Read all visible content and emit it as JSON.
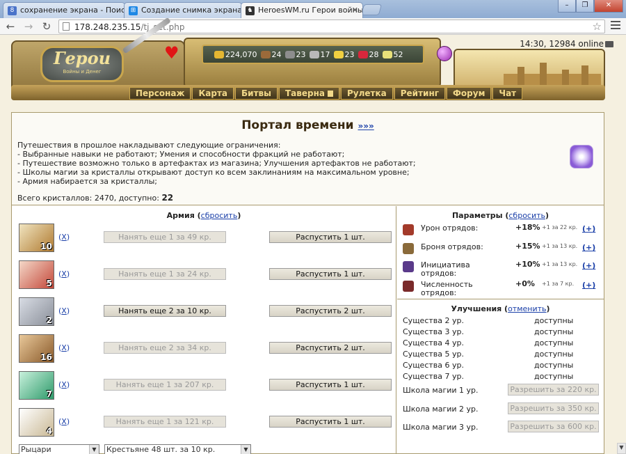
{
  "browser": {
    "tabs": [
      {
        "title": "сохранение экрана - Поиск",
        "icon_color": "#4a73c9",
        "icon_glyph": "8"
      },
      {
        "title": "Создание снимка экрана",
        "icon_color": "#1e88e5",
        "icon_glyph": "⊞"
      },
      {
        "title": "HeroesWM.ru Герои войны",
        "icon_color": "#333333",
        "icon_glyph": "♞"
      }
    ],
    "url_host": "178.248.235.15",
    "url_path": "/tj_set.php",
    "icons": [
      "back-arrow-icon",
      "forward-arrow-icon",
      "reload-icon",
      "star-icon",
      "menu-icon"
    ]
  },
  "header": {
    "logo_title": "Герои",
    "logo_subtitle": "Войны и Денег",
    "resources": [
      {
        "name": "gold",
        "value": "224,070",
        "color": "#e4b632"
      },
      {
        "name": "wood",
        "value": "24",
        "color": "#9b6a3a"
      },
      {
        "name": "ore",
        "value": "23",
        "color": "#8d8d8d"
      },
      {
        "name": "mercury",
        "value": "17",
        "color": "#b9b9b9"
      },
      {
        "name": "sulfur",
        "value": "23",
        "color": "#f0d041"
      },
      {
        "name": "crystals",
        "value": "28",
        "color": "#d8273c"
      },
      {
        "name": "gems",
        "value": "52",
        "color": "#e7e07a"
      }
    ],
    "online_text": "14:30, 12984 online",
    "menu": [
      "Персонаж",
      "Карта",
      "Битвы",
      "Таверна",
      "Рулетка",
      "Рейтинг",
      "Форум",
      "Чат"
    ]
  },
  "portal": {
    "title": "Портал времени",
    "arrows": "»»»",
    "restrictions": [
      "Путешествия в прошлое накладывают следующие ограничения:",
      "- Выбранные навыки не работают; Умения и способности фракций не работают;",
      "- Путешествие возможно только в артефактах из магазина; Улучшения артефактов не работают;",
      "- Школы магии за кристаллы открывают доступ ко всем заклинаниям на максимальном уровне;",
      "- Армия набирается за кристаллы;"
    ],
    "crystals_label": "Всего кристаллов: 2470, доступно:",
    "crystals_available": "22"
  },
  "army": {
    "title": "Армия",
    "reset_link": "сбросить",
    "remove_label": "X",
    "units": [
      {
        "count": "10",
        "hire": "Нанять еще 1 за 49 кр.",
        "hire_enabled": false,
        "dismiss": "Распустить 1 шт.",
        "color": "#b07a30"
      },
      {
        "count": "5",
        "hire": "Нанять еще 1 за 24 кр.",
        "hire_enabled": false,
        "dismiss": "Распустить 1 шт.",
        "color": "#c4483a"
      },
      {
        "count": "2",
        "hire": "Нанять еще 2 за 10 кр.",
        "hire_enabled": true,
        "dismiss": "Распустить 2 шт.",
        "color": "#8a8f99"
      },
      {
        "count": "16",
        "hire": "Нанять еще 2 за 34 кр.",
        "hire_enabled": false,
        "dismiss": "Распустить 2 шт.",
        "color": "#8a5a2a"
      },
      {
        "count": "7",
        "hire": "Нанять еще 1 за 207 кр.",
        "hire_enabled": false,
        "dismiss": "Распустить 1 шт.",
        "color": "#2f9b6b"
      },
      {
        "count": "4",
        "hire": "Нанять еще 1 за 121 кр.",
        "hire_enabled": false,
        "dismiss": "Распустить 1 шт.",
        "color": "#d8d2c0"
      }
    ],
    "faction_select": "Рыцари",
    "creature_select": "Крестьяне 48 шт. за 10 кр."
  },
  "params": {
    "title": "Параметры",
    "reset_link": "сбросить",
    "plus_label": "+",
    "rows": [
      {
        "label": "Урон отрядов:",
        "value": "+18%",
        "cost": "+1 за 22 кр.",
        "color": "#a33a2a"
      },
      {
        "label": "Броня отрядов:",
        "value": "+15%",
        "cost": "+1 за 13 кр.",
        "color": "#8a6a3a"
      },
      {
        "label": "Инициатива отрядов:",
        "value": "+10%",
        "cost": "+1 за 13 кр.",
        "color": "#5a3a8a"
      },
      {
        "label": "Численность отрядов:",
        "value": "+0%",
        "cost": "+1 за 7 кр.",
        "color": "#7a2a2a"
      }
    ]
  },
  "upgrades": {
    "title": "Улучшения",
    "cancel_link": "отменить",
    "creatures": [
      {
        "label": "Существа 2 ур.",
        "status": "доступны"
      },
      {
        "label": "Существа 3 ур.",
        "status": "доступны"
      },
      {
        "label": "Существа 4 ур.",
        "status": "доступны"
      },
      {
        "label": "Существа 5 ур.",
        "status": "доступны"
      },
      {
        "label": "Существа 6 ур.",
        "status": "доступны"
      },
      {
        "label": "Существа 7 ур.",
        "status": "доступны"
      }
    ],
    "schools": [
      {
        "label": "Школа магии 1 ур.",
        "button": "Разрешить за 220 кр."
      },
      {
        "label": "Школа магии 2 ур.",
        "button": "Разрешить за 350 кр."
      },
      {
        "label": "Школа магии 3 ур.",
        "button": "Разрешить за 600 кр."
      }
    ]
  }
}
